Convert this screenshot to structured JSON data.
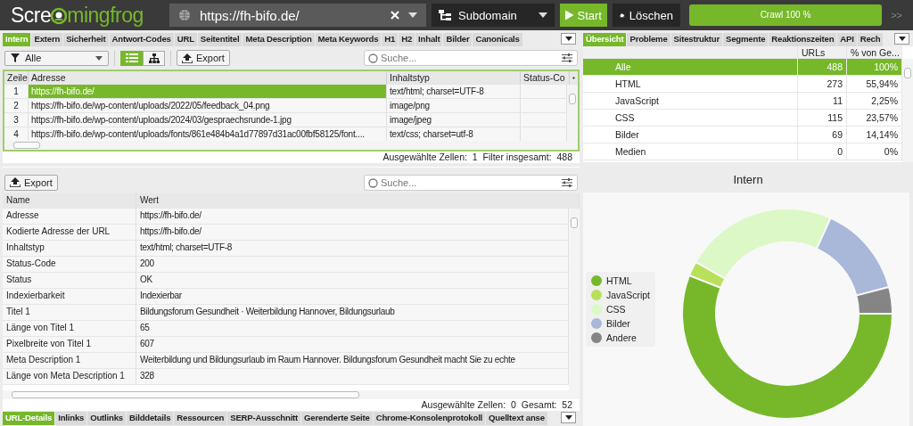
{
  "app_bar": {
    "logo": {
      "part_1": "Scre",
      "part_2": "mingfrog"
    },
    "url_field": {
      "value": "https://fh-bifo.de/"
    },
    "mode_dropdown": {
      "value": "Subdomain"
    },
    "start_button": "Start",
    "clear_button": "Löschen",
    "progress": {
      "label": "Crawl 100 %",
      "level": 1
    },
    "more_button": ">>"
  },
  "main_tabs": [
    {
      "label": "Intern",
      "selected": true
    },
    {
      "label": "Extern",
      "selected": false
    },
    {
      "label": "Sicherheit",
      "selected": false
    },
    {
      "label": "Antwort-Codes",
      "selected": false
    },
    {
      "label": "URL",
      "selected": false
    },
    {
      "label": "Seitentitel",
      "selected": false
    },
    {
      "label": "Meta Description",
      "selected": false
    },
    {
      "label": "Meta Keywords",
      "selected": false
    },
    {
      "label": "H1",
      "selected": false
    },
    {
      "label": "H2",
      "selected": false
    },
    {
      "label": "Inhalt",
      "selected": false
    },
    {
      "label": "Bilder",
      "selected": false
    },
    {
      "label": "Canonicals",
      "selected": false
    }
  ],
  "main_toolbar": {
    "filter": "Alle",
    "views": [
      {
        "kind": "list",
        "selected": true
      },
      {
        "kind": "tree",
        "selected": false
      }
    ],
    "export_button": "Export",
    "search": {
      "placeholder": "Suche..."
    }
  },
  "url_table": {
    "columns": [
      "Zeile",
      "Adresse",
      "Inhaltstyp",
      "Status-Co"
    ],
    "rows": [
      {
        "cells": [
          "1",
          "https://fh-bifo.de/",
          "text/html; charset=UTF-8",
          ""
        ],
        "selected": true
      },
      {
        "cells": [
          "2",
          "https://fh-bifo.de/wp-content/uploads/2022/05/feedback_04.png",
          "image/png",
          ""
        ],
        "selected": false
      },
      {
        "cells": [
          "3",
          "https://fh-bifo.de/wp-content/uploads/2024/03/gespraechsrunde-1.jpg",
          "image/jpeg",
          ""
        ],
        "selected": false
      },
      {
        "cells": [
          "4",
          "https://fh-bifo.de/wp-content/uploads/fonts/861e484b4a1d77897d31ac00fbf58125/font....",
          "text/css; charset=utf-8",
          ""
        ],
        "selected": false
      }
    ],
    "status": [
      {
        "label": "Ausgewählte Zellen:",
        "value": "1"
      },
      {
        "label": "Filter insgesamt:",
        "value": "488"
      }
    ]
  },
  "details": {
    "export_button": "Export",
    "search": {
      "placeholder": "Suche..."
    },
    "columns": [
      "Name",
      "Wert"
    ],
    "rows": [
      [
        "Adresse",
        "https://fh-bifo.de/"
      ],
      [
        "Kodierte Adresse der URL",
        "https://fh-bifo.de/"
      ],
      [
        "Inhaltstyp",
        "text/html; charset=UTF-8"
      ],
      [
        "Status-Code",
        "200"
      ],
      [
        "Status",
        "OK"
      ],
      [
        "Indexierbarkeit",
        "Indexierbar"
      ],
      [
        "Titel 1",
        "Bildungsforum Gesundheit · Weiterbildung Hannover, Bildungsurlaub"
      ],
      [
        "Länge von Titel 1",
        "65"
      ],
      [
        "Pixelbreite von Titel 1",
        "607"
      ],
      [
        "Meta Description 1",
        "Weiterbildung und Bildungsurlaub im Raum Hannover. Bildungsforum Gesundheit macht Sie zu echte"
      ],
      [
        "Länge von Meta Description 1",
        "328"
      ]
    ],
    "status": [
      {
        "label": "Ausgewählte Zellen:",
        "value": "0"
      },
      {
        "label": "Gesamt:",
        "value": "52"
      }
    ]
  },
  "bottom_tabs": [
    {
      "label": "URL-Details",
      "selected": true
    },
    {
      "label": "Inlinks",
      "selected": false
    },
    {
      "label": "Outlinks",
      "selected": false
    },
    {
      "label": "Bilddetails",
      "selected": false
    },
    {
      "label": "Ressourcen",
      "selected": false
    },
    {
      "label": "SERP-Ausschnitt",
      "selected": false
    },
    {
      "label": "Gerenderte Seite",
      "selected": false
    },
    {
      "label": "Chrome-Konsolenprotokoll",
      "selected": false
    },
    {
      "label": "Quelltext anse",
      "selected": false
    }
  ],
  "side_tabs": [
    {
      "label": "Übersicht",
      "selected": true
    },
    {
      "label": "Probleme",
      "selected": false
    },
    {
      "label": "Sitestruktur",
      "selected": false
    },
    {
      "label": "Segmente",
      "selected": false
    },
    {
      "label": "Reaktionszeiten",
      "selected": false
    },
    {
      "label": "API",
      "selected": false
    },
    {
      "label": "Rech",
      "selected": false
    }
  ],
  "overview_table": {
    "columns": [
      "URLs",
      "% von Ge..."
    ],
    "rows": [
      {
        "name": "Alle",
        "urls": "488",
        "percent": "100%",
        "selected": true
      },
      {
        "name": "HTML",
        "urls": "273",
        "percent": "55,94%",
        "selected": false
      },
      {
        "name": "JavaScript",
        "urls": "11",
        "percent": "2,25%",
        "selected": false
      },
      {
        "name": "CSS",
        "urls": "115",
        "percent": "23,57%",
        "selected": false
      },
      {
        "name": "Bilder",
        "urls": "69",
        "percent": "14,14%",
        "selected": false
      },
      {
        "name": "Medien",
        "urls": "0",
        "percent": "0%",
        "selected": false
      }
    ]
  },
  "chart_panel": {
    "chart_data": {
      "type": "donut",
      "title": "Intern",
      "legend": "left",
      "categories": [
        "HTML",
        "JavaScript",
        "CSS",
        "Bilder",
        "Andere"
      ],
      "values": [
        55.94,
        2.25,
        23.57,
        14.14,
        4.1
      ],
      "colors": [
        "#76b82a",
        "#b9e05a",
        "#dcf8c6",
        "#a9b7d9",
        "#858585"
      ]
    }
  }
}
